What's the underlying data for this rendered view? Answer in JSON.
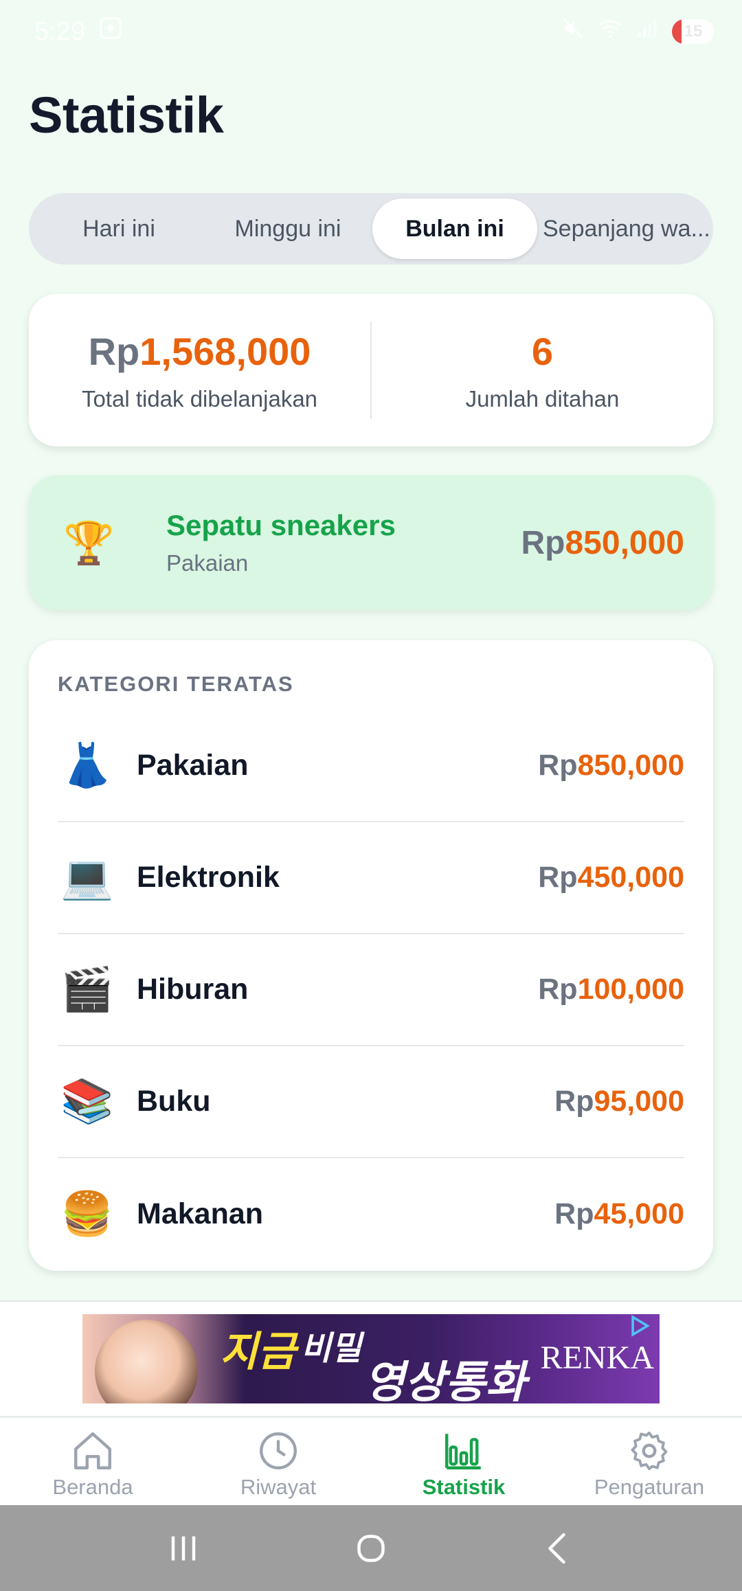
{
  "status_bar": {
    "time": "5:29",
    "battery": "15"
  },
  "page": {
    "title": "Statistik"
  },
  "tabs": [
    {
      "label": "Hari ini",
      "active": false
    },
    {
      "label": "Minggu ini",
      "active": false
    },
    {
      "label": "Bulan ini",
      "active": true
    },
    {
      "label": "Sepanjang wa...",
      "active": false
    }
  ],
  "summary": {
    "currency": "Rp",
    "total_amount": "1,568,000",
    "total_label": "Total tidak dibelanjakan",
    "count": "6",
    "count_label": "Jumlah ditahan"
  },
  "top_item": {
    "icon": "trophy-icon",
    "emoji": "🏆",
    "name": "Sepatu sneakers",
    "category": "Pakaian",
    "currency": "Rp",
    "amount": "850,000"
  },
  "categories": {
    "header": "KATEGORI TERATAS",
    "items": [
      {
        "icon": "dress-icon",
        "emoji": "👗",
        "name": "Pakaian",
        "currency": "Rp",
        "amount": "850,000"
      },
      {
        "icon": "laptop-icon",
        "emoji": "💻",
        "name": "Elektronik",
        "currency": "Rp",
        "amount": "450,000"
      },
      {
        "icon": "clapper-board-icon",
        "emoji": "🎬",
        "name": "Hiburan",
        "currency": "Rp",
        "amount": "100,000"
      },
      {
        "icon": "books-icon",
        "emoji": "📚",
        "name": "Buku",
        "currency": "Rp",
        "amount": "95,000"
      },
      {
        "icon": "hamburger-icon",
        "emoji": "🍔",
        "name": "Makanan",
        "currency": "Rp",
        "amount": "45,000"
      }
    ]
  },
  "ad": {
    "text_1": "지금",
    "text_2": "비밀",
    "text_3": "영상통화",
    "brand": "RENKA"
  },
  "bottom_nav": [
    {
      "label": "Beranda",
      "icon": "home-icon",
      "active": false
    },
    {
      "label": "Riwayat",
      "icon": "clock-icon",
      "active": false
    },
    {
      "label": "Statistik",
      "icon": "bar-chart-icon",
      "active": true
    },
    {
      "label": "Pengaturan",
      "icon": "gear-icon",
      "active": false
    }
  ],
  "colors": {
    "accent_orange": "#e8620c",
    "accent_green": "#16a34a",
    "background": "#effbf3"
  }
}
